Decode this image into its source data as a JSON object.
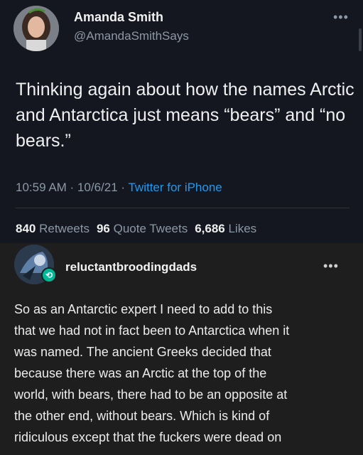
{
  "tweet": {
    "author_name": "Amanda Smith",
    "author_handle": "@AmandaSmithSays",
    "more_icon": "more-horizontal-icon",
    "text": "Thinking again about how the names Arctic and Antarctica just means “bears” and “no bears.”",
    "time": "10:59 AM · 10/6/21 · ",
    "source": "Twitter for iPhone",
    "stats": {
      "retweets_count": "840",
      "retweets_label": " Retweets",
      "quotes_count": "96",
      "quotes_label": " Quote Tweets",
      "likes_count": "6,686",
      "likes_label": " Likes"
    },
    "colors": {
      "background": "#14171f",
      "link": "#1d9bf0",
      "muted": "#8b98a5"
    }
  },
  "tumblr": {
    "username": "reluctantbroodingdads",
    "badge_icon": "reblog-icon",
    "more_icon": "more-horizontal-icon",
    "text_lines": [
      "So as an Antarctic expert I need to add to this",
      "that we had not in fact been to Antarctica when it",
      "was named. The ancient Greeks decided that",
      "because there was an Arctic at the top of the",
      "world, with bears, there had to be an opposite at",
      "the other end, without bears. Which is kind of",
      "ridiculous except that the fuckers were dead on"
    ],
    "colors": {
      "background": "#1e1e1e",
      "badge": "#00b894"
    }
  }
}
